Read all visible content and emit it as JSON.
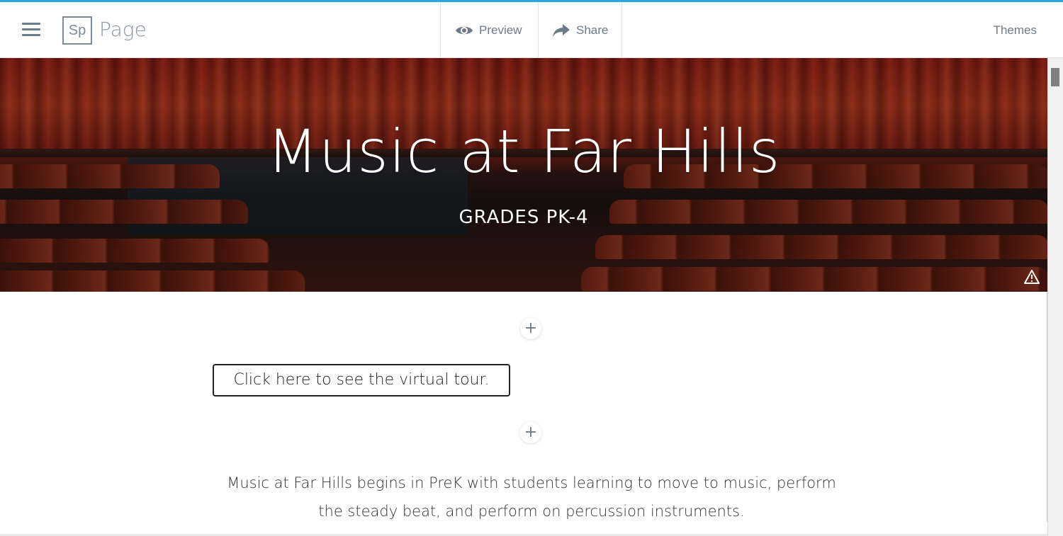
{
  "app": {
    "logo_text": "Sp",
    "name": "Page"
  },
  "toolbar": {
    "preview_label": "Preview",
    "share_label": "Share",
    "themes_label": "Themes"
  },
  "hero": {
    "title": "Music at Far Hills",
    "subtitle": "GRADES PK-4"
  },
  "content": {
    "tour_button_label": "Click here to see the virtual tour.",
    "paragraph_line1": "Music at Far Hills begins in PreK with students learning to move to music, perform",
    "paragraph_line2": "the steady beat, and perform on percussion instruments."
  },
  "icons": {
    "menu": "hamburger-menu-icon",
    "preview": "eye-icon",
    "share": "share-arrow-icon",
    "warning": "warning-triangle-icon",
    "add": "plus-icon"
  },
  "colors": {
    "accent_bar": "#2aa6dc",
    "toolbar_text": "#6c7a89",
    "curtain_red": "#a8331c"
  }
}
